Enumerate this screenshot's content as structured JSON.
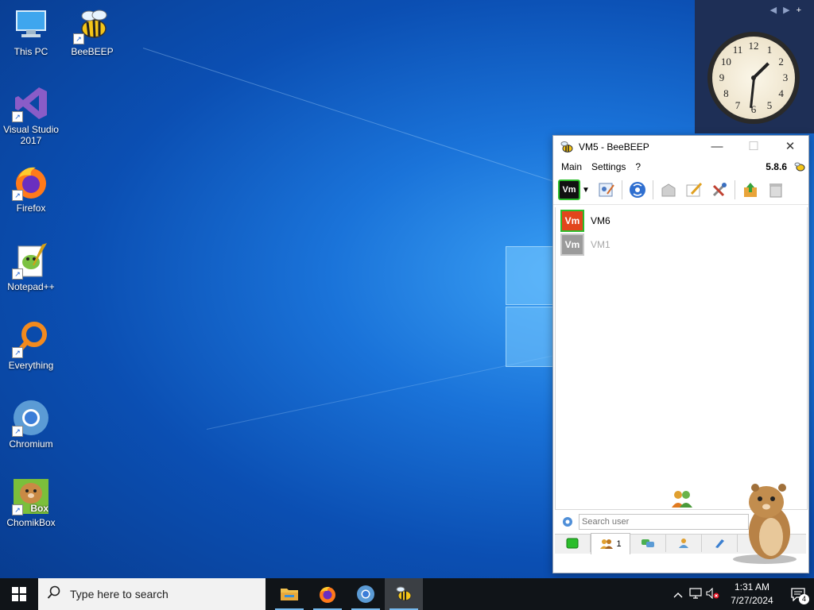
{
  "desktop": {
    "icons": [
      {
        "label": "This PC",
        "icon": "computer-icon"
      },
      {
        "label": "BeeBEEP",
        "icon": "bee-icon"
      },
      {
        "label": "Visual Studio 2017",
        "icon": "visual-studio-icon"
      },
      {
        "label": "Firefox",
        "icon": "firefox-icon"
      },
      {
        "label": "Notepad++",
        "icon": "notepad-plus-plus-icon"
      },
      {
        "label": "Everything",
        "icon": "everything-search-icon"
      },
      {
        "label": "Chromium",
        "icon": "chromium-icon"
      },
      {
        "label": "ChomikBox",
        "icon": "chomikbox-icon",
        "badge": "Box"
      }
    ]
  },
  "gadget": {
    "controls": [
      "◀",
      "▶",
      "+"
    ],
    "clock": {
      "numbers": [
        "12",
        "1",
        "2",
        "3",
        "4",
        "5",
        "6",
        "7",
        "8",
        "9",
        "10",
        "11"
      ],
      "hour": 1,
      "minute": 31
    }
  },
  "beebeep": {
    "title": "VM5 - BeeBEEP",
    "controls": {
      "minimize": "—",
      "maximize": "☐",
      "close": "✕"
    },
    "menu": [
      "Main",
      "Settings",
      "?"
    ],
    "version": "5.8.6",
    "status_avatar": "Vm",
    "users": [
      {
        "avatar": "Vm",
        "name": "VM6",
        "online": true,
        "color": "#e2461c"
      },
      {
        "avatar": "Vm",
        "name": "VM1",
        "online": false,
        "color": "#9b9b9b"
      }
    ],
    "search_placeholder": "Search user",
    "tabs": [
      {
        "icon": "status-icon",
        "label": ""
      },
      {
        "icon": "users-icon",
        "label": "1"
      },
      {
        "icon": "chat-icon",
        "label": ""
      },
      {
        "icon": "groups-icon",
        "label": ""
      },
      {
        "icon": "files-icon",
        "label": ""
      }
    ]
  },
  "taskbar": {
    "search_placeholder": "Type here to search",
    "apps": [
      "file-explorer-icon",
      "firefox-icon",
      "chromium-icon",
      "beebeep-icon"
    ],
    "time": "1:31 AM",
    "date": "7/27/2024",
    "notification_count": "4"
  }
}
